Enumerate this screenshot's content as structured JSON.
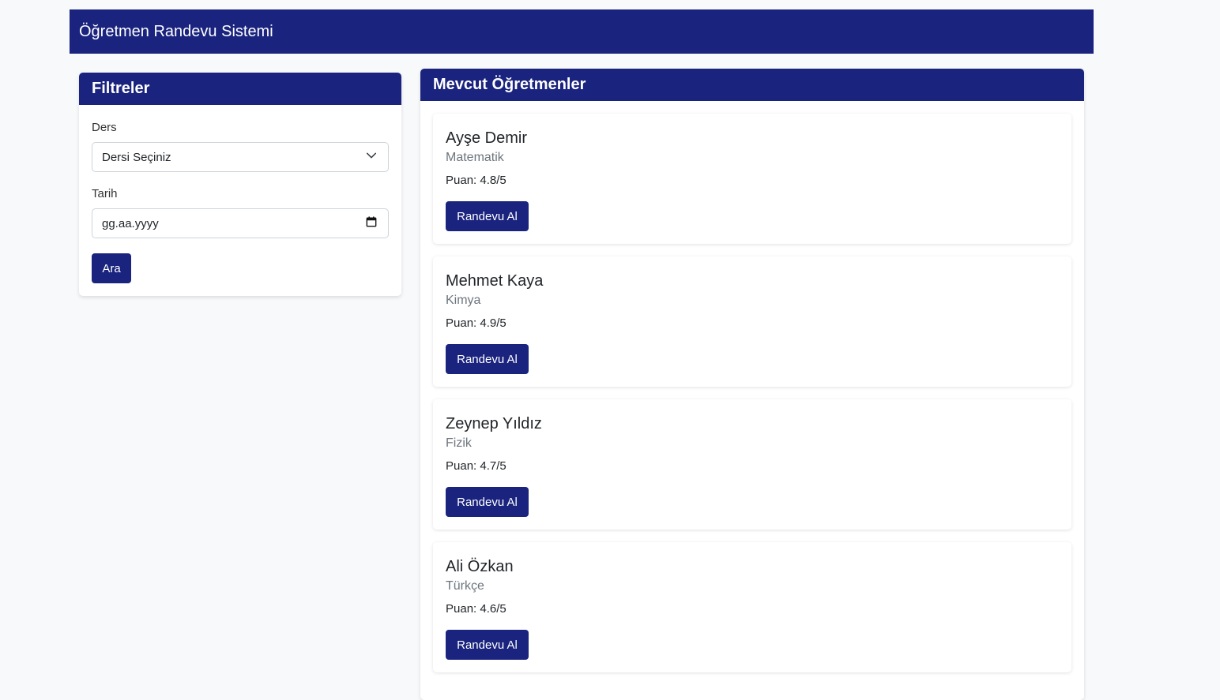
{
  "navbar": {
    "brand": "Öğretmen Randevu Sistemi"
  },
  "filters": {
    "title": "Filtreler",
    "subject_label": "Ders",
    "subject_selected": "Dersi Seçiniz",
    "date_label": "Tarih",
    "date_placeholder": "gg.aa.yyyy",
    "search_label": "Ara"
  },
  "teachers": {
    "title": "Mevcut Öğretmenler",
    "rating_prefix": "Puan:",
    "book_label": "Randevu Al",
    "items": [
      {
        "name": "Ayşe Demir",
        "subject": "Matematik",
        "rating": "Puan: 4.8/5",
        "button": "Randevu Al"
      },
      {
        "name": "Mehmet Kaya",
        "subject": "Kimya",
        "rating": "Puan: 4.9/5",
        "button": "Randevu Al"
      },
      {
        "name": "Zeynep Yıldız",
        "subject": "Fizik",
        "rating": "Puan: 4.7/5",
        "button": "Randevu Al"
      },
      {
        "name": "Ali Özkan",
        "subject": "Türkçe",
        "rating": "Puan: 4.6/5",
        "button": "Randevu Al"
      }
    ]
  },
  "colors": {
    "primary": "#1a237e",
    "background": "#f8f9fb",
    "muted_text": "#6c757d"
  },
  "icons": {
    "select": "chevron-down-icon",
    "date": "calendar-icon"
  }
}
